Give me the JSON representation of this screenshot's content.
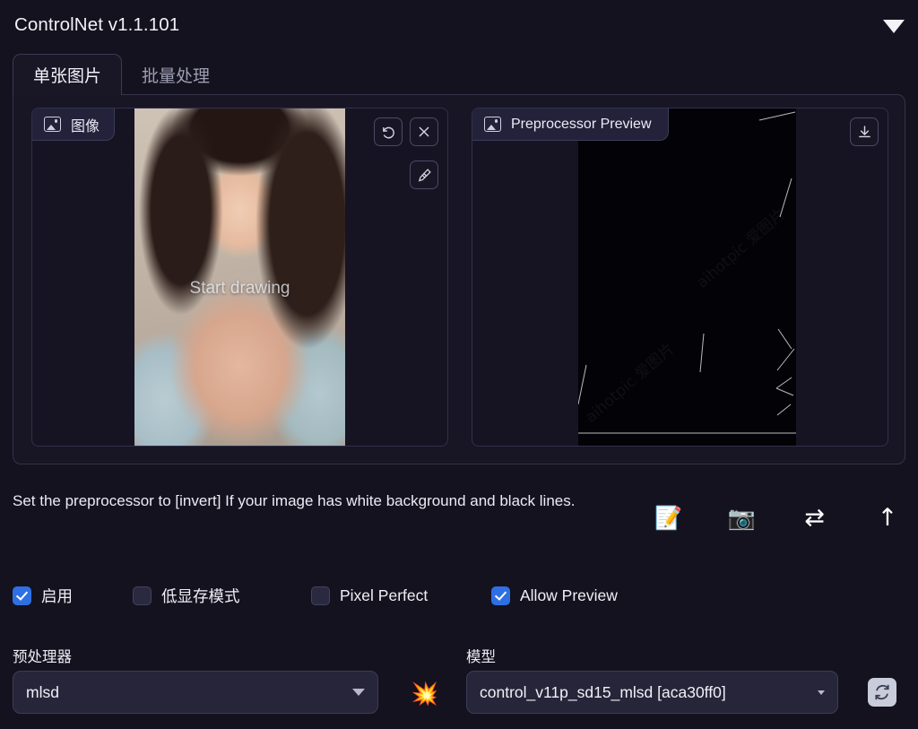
{
  "window": {
    "title": "ControlNet v1.1.101",
    "collapse_icon": "triangle-down-icon"
  },
  "tabs": [
    {
      "label": "单张图片",
      "active": true
    },
    {
      "label": "批量处理",
      "active": false
    }
  ],
  "image_pane": {
    "tag_label": "图像",
    "tag_icon": "picture-icon",
    "overlay_text": "Start drawing",
    "tools": [
      {
        "name": "undo-button",
        "icon": "undo-icon"
      },
      {
        "name": "clear-button",
        "icon": "close-icon"
      },
      {
        "name": "draw-button",
        "icon": "pen-icon"
      }
    ]
  },
  "preview_pane": {
    "tag_label": "Preprocessor Preview",
    "tag_icon": "picture-icon",
    "tools": [
      {
        "name": "download-button",
        "icon": "download-icon"
      }
    ],
    "watermark": "aihotpic 爱图片"
  },
  "hint": {
    "text": "Set the preprocessor to [invert] If your image has white background and black lines."
  },
  "quick_actions": [
    {
      "name": "open-new-canvas-button",
      "icon": "📝",
      "label": "memo-icon"
    },
    {
      "name": "camera-capture-button",
      "icon": "📷",
      "label": "camera-icon"
    },
    {
      "name": "swap-images-button",
      "icon": "⇄",
      "label": "swap-arrows-icon"
    },
    {
      "name": "send-to-button",
      "icon": "↑",
      "label": "up-arrow-icon"
    }
  ],
  "checkboxes": [
    {
      "label": "启用",
      "checked": true
    },
    {
      "label": "低显存模式",
      "checked": false
    },
    {
      "label": "Pixel Perfect",
      "checked": false
    },
    {
      "label": "Allow Preview",
      "checked": true
    }
  ],
  "preprocessor": {
    "label": "预处理器",
    "value": "mlsd",
    "run_button_icon": "💥"
  },
  "model": {
    "label": "模型",
    "value": "control_v11p_sd15_mlsd [aca30ff0]",
    "refresh_button_icon": "refresh-icon"
  },
  "colors": {
    "background": "#14121e",
    "panel": "#181624",
    "accent_blue": "#2f6fe4",
    "border": "#34334a",
    "text": "#eceaf4"
  }
}
